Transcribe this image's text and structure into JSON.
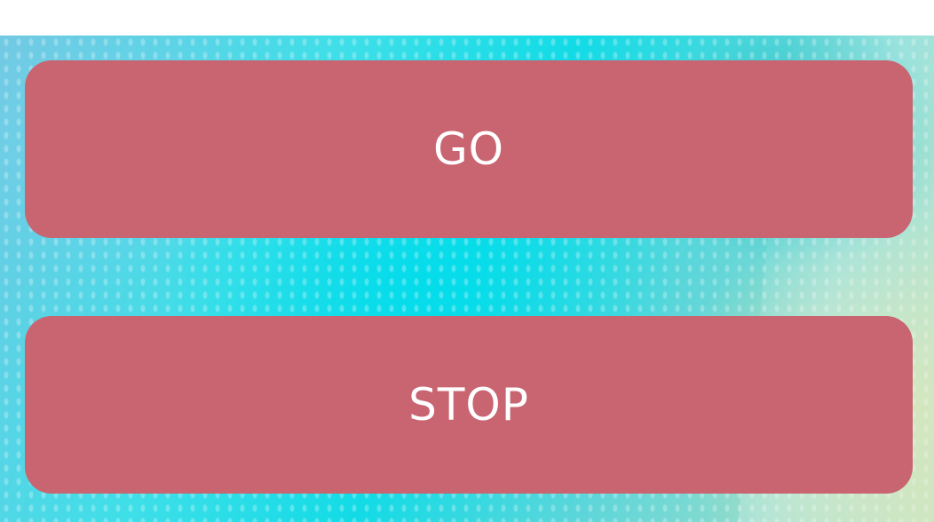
{
  "buttons": {
    "go_label": "GO",
    "stop_label": "STOP"
  },
  "colors": {
    "button_background": "#c96471",
    "button_text": "#ffffff"
  }
}
